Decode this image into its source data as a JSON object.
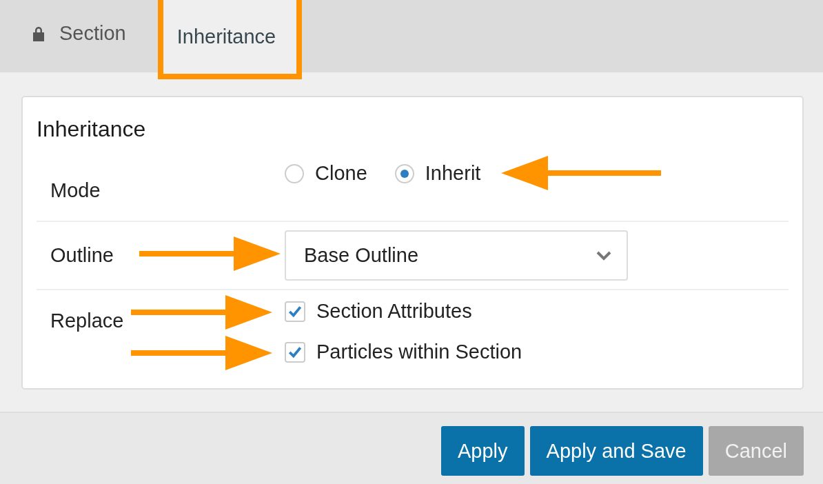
{
  "tabs": [
    {
      "label": "Section",
      "locked": true,
      "selected": false,
      "highlighted": false
    },
    {
      "label": "Inheritance",
      "locked": false,
      "selected": true,
      "highlighted": true
    }
  ],
  "panel": {
    "title": "Inheritance",
    "mode": {
      "label": "Mode",
      "arrow": true,
      "options": [
        {
          "label": "Clone",
          "selected": false
        },
        {
          "label": "Inherit",
          "selected": true
        }
      ]
    },
    "outline": {
      "label": "Outline",
      "value": "Base Outline",
      "arrow": true
    },
    "replace": {
      "label": "Replace",
      "options": [
        {
          "label": "Section Attributes",
          "checked": true,
          "arrow": true
        },
        {
          "label": "Particles within Section",
          "checked": true,
          "arrow": true
        }
      ]
    }
  },
  "buttons": [
    {
      "label": "Apply",
      "kind": "primary",
      "disabled": false
    },
    {
      "label": "Apply and Save",
      "kind": "primary",
      "disabled": false
    },
    {
      "label": "Cancel",
      "kind": "secondary",
      "disabled": true
    }
  ]
}
